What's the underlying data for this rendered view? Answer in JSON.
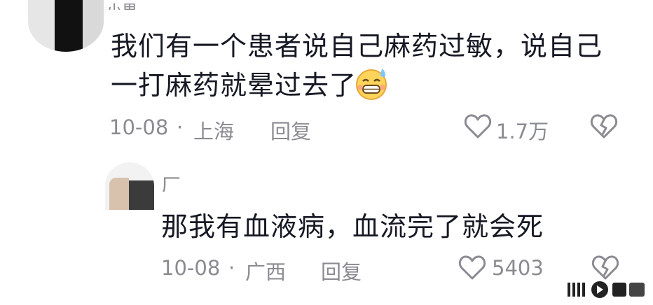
{
  "comments": [
    {
      "author_partial": "小果",
      "text_line1": "我们有一个患者说自己麻药过敏，说自己",
      "text_line2": "一打麻药就晕过去了",
      "emoji": "grinning-sweat-emoji",
      "date": "10-08",
      "location": "上海",
      "separator": "·",
      "reply_label": "回复",
      "like_count": "1.7万"
    },
    {
      "author_partial": "厂",
      "text": "那我有血液病，血流完了就会死",
      "date": "10-08",
      "location": "广西",
      "separator": "·",
      "reply_label": "回复",
      "like_count": "5403"
    }
  ],
  "watermark": {
    "icon": "douyin-logo-icon"
  }
}
